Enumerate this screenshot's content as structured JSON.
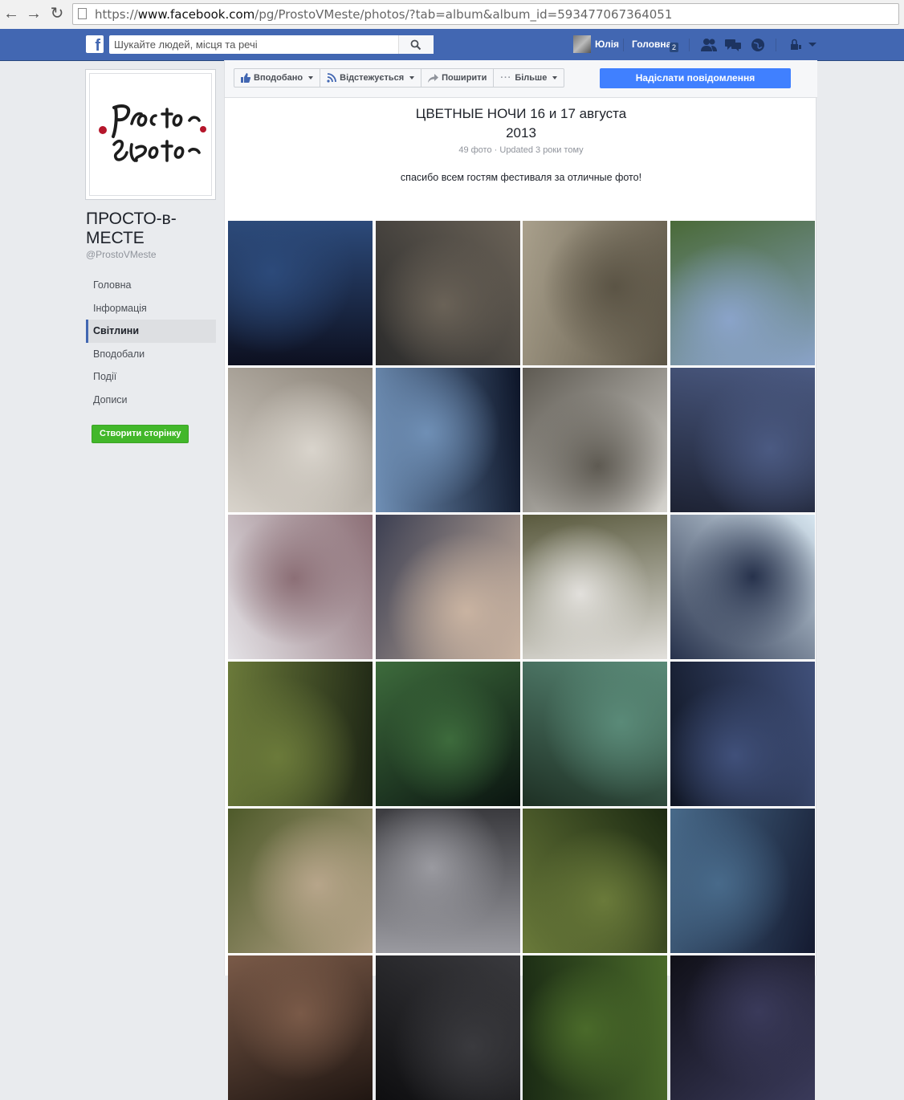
{
  "browser": {
    "url_prefix": "https://",
    "url_host": "www.facebook.com",
    "url_path": "/pg/ProstoVMeste/photos/?tab=album&album_id=593477067364051"
  },
  "topbar": {
    "logo": "f",
    "search_placeholder": "Шукайте людей, місця та речі",
    "user_name": "Юлія",
    "home_label": "Головна",
    "home_badge": "2"
  },
  "sidebar": {
    "page_name": "ПРОСТО-в-МЕСТЕ",
    "username": "@ProstoVMeste",
    "items": [
      {
        "label": "Головна"
      },
      {
        "label": "Інформація"
      },
      {
        "label": "Світлини"
      },
      {
        "label": "Вподобали"
      },
      {
        "label": "Події"
      },
      {
        "label": "Дописи"
      }
    ],
    "create_page": "Створити сторінку"
  },
  "actions": {
    "liked": "Вподобано",
    "following": "Відстежується",
    "share": "Поширити",
    "more": "Більше",
    "send_message": "Надіслати повідомлення"
  },
  "album": {
    "title_line1": "ЦВЕТНЫЕ НОЧИ 16 и 17 августа",
    "title_line2": "2013",
    "meta": "49 фото · Updated 3 роки тому",
    "description": "спасибо всем гостям фестиваля за отличные фото!"
  },
  "photo_colors": [
    [
      "#0d1020",
      "#2c4a7a"
    ],
    [
      "#2b2b2b",
      "#6a6257"
    ],
    [
      "#a9a08c",
      "#5b5445"
    ],
    [
      "#4a6a38",
      "#8aa3c9"
    ],
    [
      "#8a8277",
      "#d9d4cc"
    ],
    [
      "#0d1528",
      "#6f8fb5"
    ],
    [
      "#d6d4cf",
      "#5e5a52"
    ],
    [
      "#1d2233",
      "#4b5a82"
    ],
    [
      "#e4e2e6",
      "#8c6f76"
    ],
    [
      "#3c3f52",
      "#c9b3a1"
    ],
    [
      "#5a5a3e",
      "#e2e0dc"
    ],
    [
      "#d7e6f0",
      "#27324c"
    ],
    [
      "#1c2414",
      "#6b7a3a"
    ],
    [
      "#0a1410",
      "#3d6b3c"
    ],
    [
      "#1e3024",
      "#5a8a78"
    ],
    [
      "#101624",
      "#40507a"
    ],
    [
      "#4e5a2a",
      "#b7a58a"
    ],
    [
      "#3a3a3e",
      "#9a9aa0"
    ],
    [
      "#1c2a12",
      "#6a7a3a"
    ],
    [
      "#141a30",
      "#486a8a"
    ],
    [
      "#201612",
      "#7a5a48"
    ],
    [
      "#0e0e10",
      "#3a3a3e"
    ],
    [
      "#1a2a14",
      "#4a6a2a"
    ],
    [
      "#101018",
      "#3a3a5a"
    ]
  ]
}
